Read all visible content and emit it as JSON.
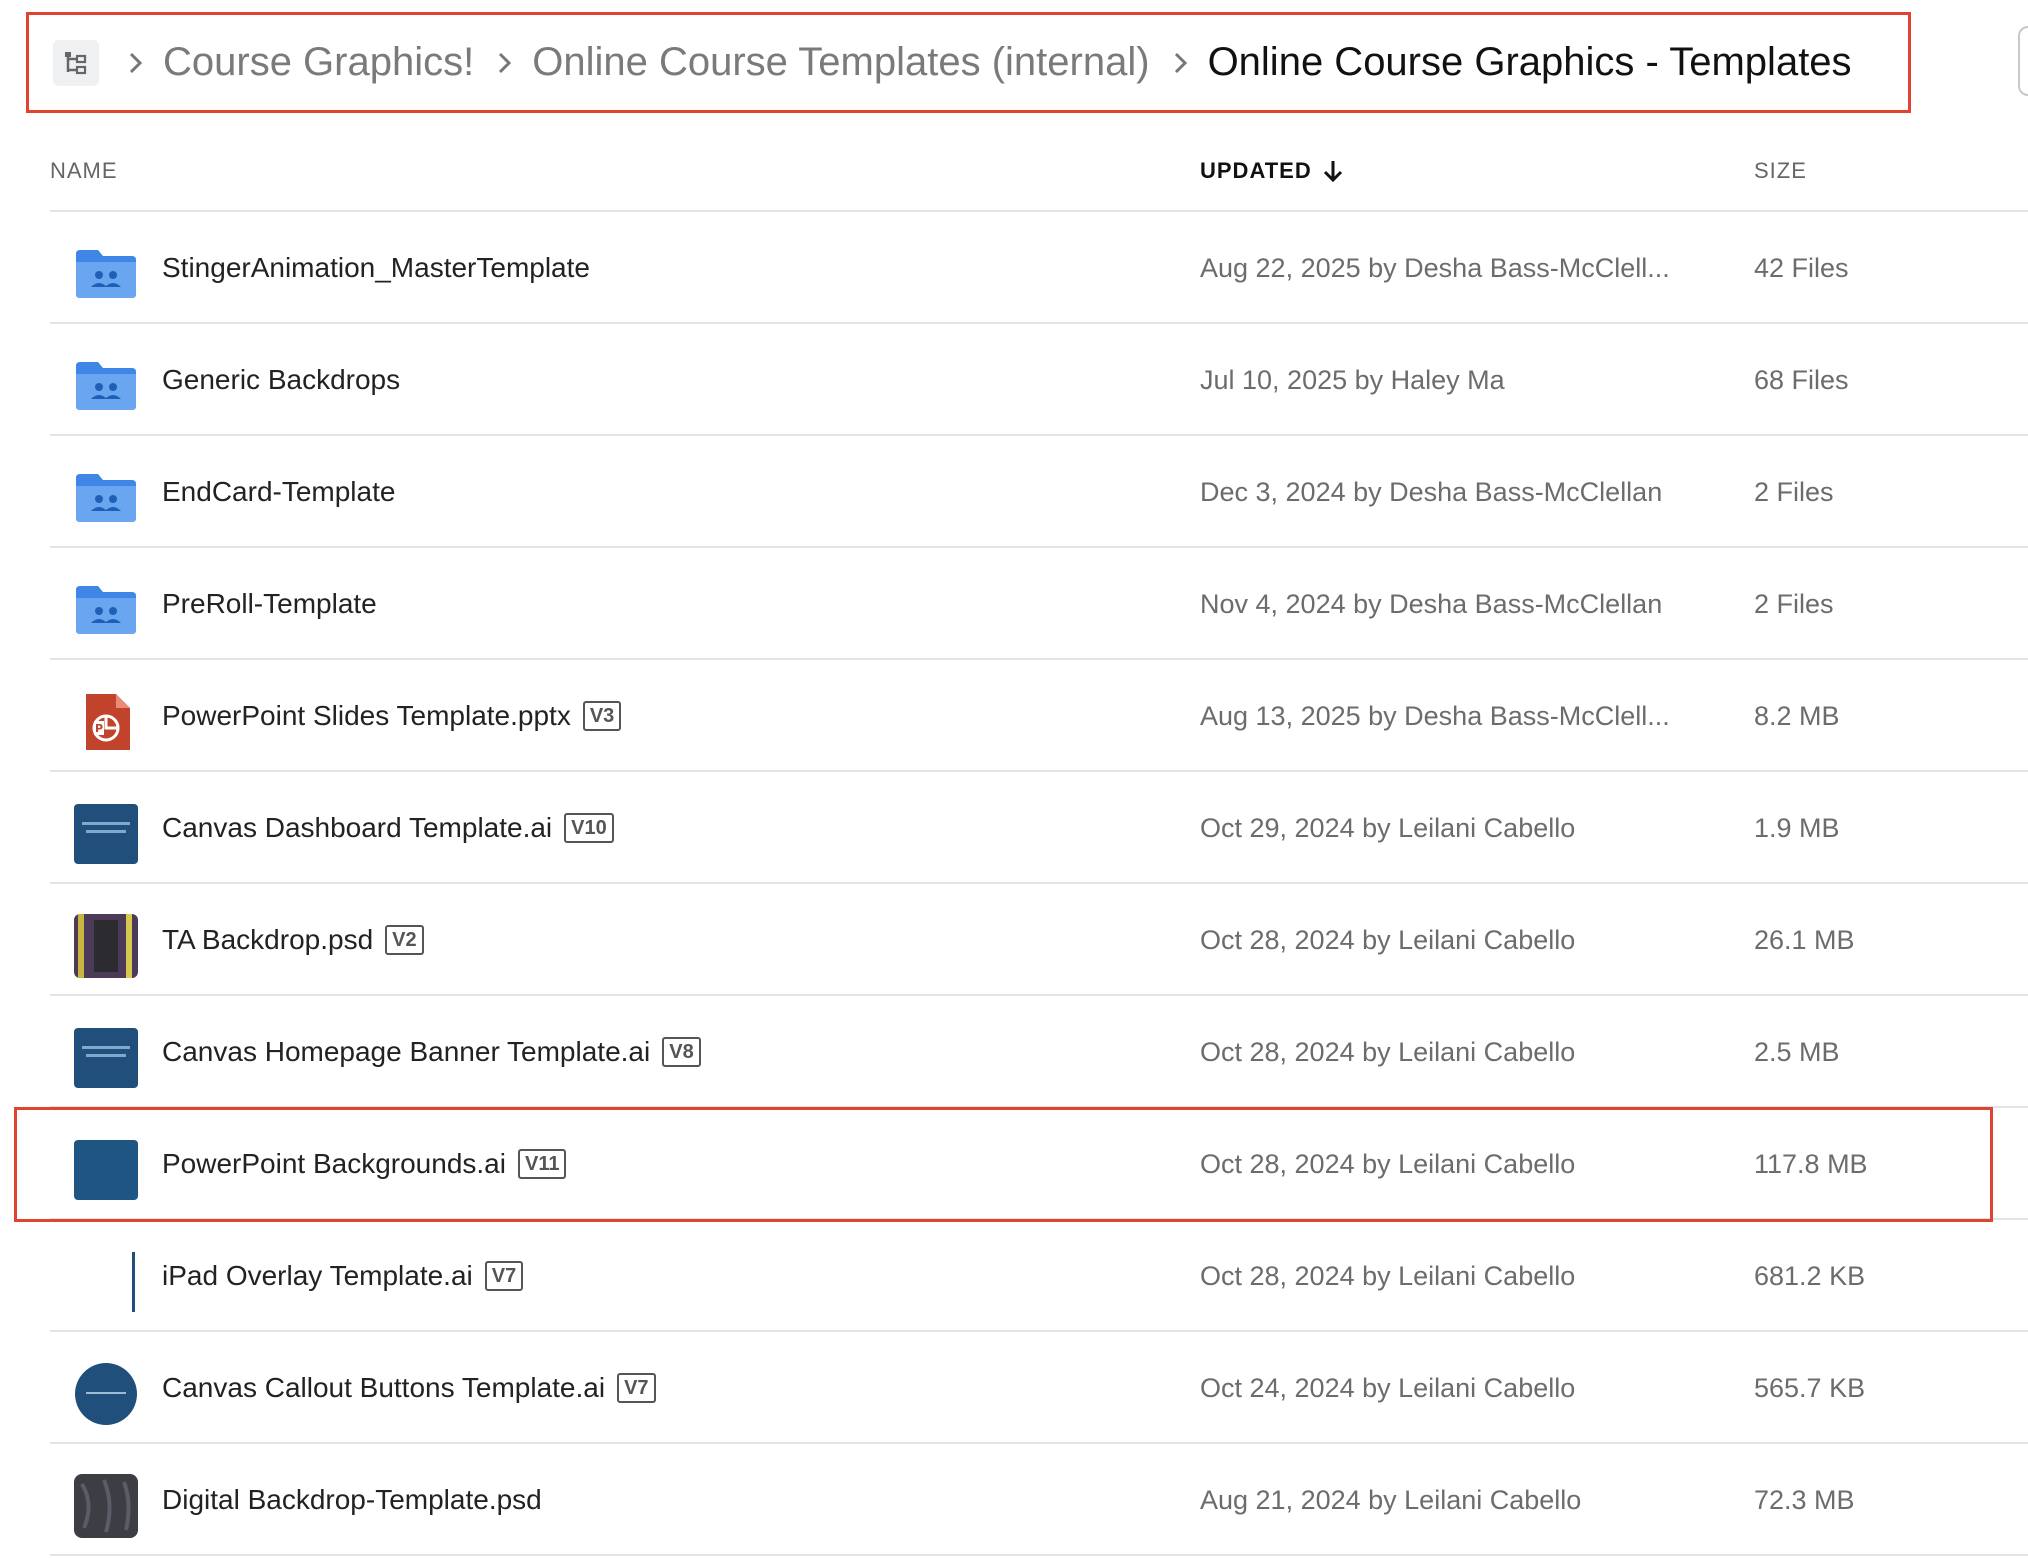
{
  "breadcrumb": {
    "items": [
      "Course Graphics!",
      "Online Course Templates (internal)"
    ],
    "current": "Online Course Graphics - Templates"
  },
  "table": {
    "headers": {
      "name": "NAME",
      "updated": "UPDATED",
      "size": "SIZE"
    },
    "rows": [
      {
        "name": "StingerAnimation_MasterTemplate",
        "version": "",
        "updated": "Aug 22, 2025 by Desha Bass-McClell...",
        "size": "42 Files",
        "icon": "shared-folder-icon"
      },
      {
        "name": "Generic Backdrops",
        "version": "",
        "updated": "Jul 10, 2025 by Haley Ma",
        "size": "68 Files",
        "icon": "shared-folder-icon"
      },
      {
        "name": "EndCard-Template",
        "version": "",
        "updated": "Dec 3, 2024 by Desha Bass-McClellan",
        "size": "2 Files",
        "icon": "shared-folder-icon"
      },
      {
        "name": "PreRoll-Template",
        "version": "",
        "updated": "Nov 4, 2024 by Desha Bass-McClellan",
        "size": "2 Files",
        "icon": "shared-folder-icon"
      },
      {
        "name": "PowerPoint Slides Template.pptx",
        "version": "V3",
        "updated": "Aug 13, 2025 by Desha Bass-McClell...",
        "size": "8.2 MB",
        "icon": "powerpoint-file-icon"
      },
      {
        "name": "Canvas Dashboard Template.ai",
        "version": "V10",
        "updated": "Oct 29, 2024 by Leilani Cabello",
        "size": "1.9 MB",
        "icon": "ai-thumbnail-icon"
      },
      {
        "name": "TA Backdrop.psd",
        "version": "V2",
        "updated": "Oct 28, 2024 by Leilani Cabello",
        "size": "26.1 MB",
        "icon": "psd-thumbnail-icon"
      },
      {
        "name": "Canvas Homepage Banner Template.ai",
        "version": "V8",
        "updated": "Oct 28, 2024 by Leilani Cabello",
        "size": "2.5 MB",
        "icon": "ai-thumbnail-icon"
      },
      {
        "name": "PowerPoint Backgrounds.ai",
        "version": "V11",
        "updated": "Oct 28, 2024 by Leilani Cabello",
        "size": "117.8 MB",
        "icon": "ai-thumbnail-icon"
      },
      {
        "name": "iPad Overlay Template.ai",
        "version": "V7",
        "updated": "Oct 28, 2024 by Leilani Cabello",
        "size": "681.2 KB",
        "icon": "ai-thumbnail-icon"
      },
      {
        "name": "Canvas Callout Buttons Template.ai",
        "version": "V7",
        "updated": "Oct 24, 2024 by Leilani Cabello",
        "size": "565.7 KB",
        "icon": "ai-thumbnail-icon"
      },
      {
        "name": "Digital Backdrop-Template.psd",
        "version": "",
        "updated": "Aug 21, 2024 by Leilani Cabello",
        "size": "72.3 MB",
        "icon": "psd-thumbnail-icon"
      }
    ]
  },
  "colors": {
    "highlight": "#e0432f",
    "folder": "#4a8fe8",
    "thumb_dark": "#1f4f7a"
  }
}
